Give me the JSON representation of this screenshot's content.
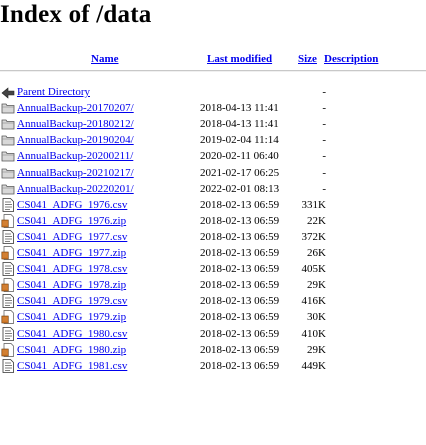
{
  "page": {
    "title": "Index of /data"
  },
  "columns": {
    "name": "Name",
    "last_modified": "Last modified",
    "size": "Size",
    "description": "Description"
  },
  "rows": [
    {
      "icon": "back-icon",
      "name": "Parent Directory",
      "date": "",
      "size": "-"
    },
    {
      "icon": "folder-icon",
      "name": "AnnualBackup-20170207/",
      "date": "2018-04-13 11:41",
      "size": "-"
    },
    {
      "icon": "folder-icon",
      "name": "AnnualBackup-20180212/",
      "date": "2018-04-13 11:41",
      "size": "-"
    },
    {
      "icon": "folder-icon",
      "name": "AnnualBackup-20190204/",
      "date": "2019-02-04 11:14",
      "size": "-"
    },
    {
      "icon": "folder-icon",
      "name": "AnnualBackup-20200211/",
      "date": "2020-02-11 06:40",
      "size": "-"
    },
    {
      "icon": "folder-icon",
      "name": "AnnualBackup-20210217/",
      "date": "2021-02-17 06:25",
      "size": "-"
    },
    {
      "icon": "folder-icon",
      "name": "AnnualBackup-20220201/",
      "date": "2022-02-01 08:13",
      "size": "-"
    },
    {
      "icon": "text-file-icon",
      "name": "CS041_ADFG_1976.csv",
      "date": "2018-02-13 06:59",
      "size": "331K"
    },
    {
      "icon": "compressed-file-icon",
      "name": "CS041_ADFG_1976.zip",
      "date": "2018-02-13 06:59",
      "size": "22K"
    },
    {
      "icon": "text-file-icon",
      "name": "CS041_ADFG_1977.csv",
      "date": "2018-02-13 06:59",
      "size": "372K"
    },
    {
      "icon": "compressed-file-icon",
      "name": "CS041_ADFG_1977.zip",
      "date": "2018-02-13 06:59",
      "size": "26K"
    },
    {
      "icon": "text-file-icon",
      "name": "CS041_ADFG_1978.csv",
      "date": "2018-02-13 06:59",
      "size": "405K"
    },
    {
      "icon": "compressed-file-icon",
      "name": "CS041_ADFG_1978.zip",
      "date": "2018-02-13 06:59",
      "size": "29K"
    },
    {
      "icon": "text-file-icon",
      "name": "CS041_ADFG_1979.csv",
      "date": "2018-02-13 06:59",
      "size": "416K"
    },
    {
      "icon": "compressed-file-icon",
      "name": "CS041_ADFG_1979.zip",
      "date": "2018-02-13 06:59",
      "size": "30K"
    },
    {
      "icon": "text-file-icon",
      "name": "CS041_ADFG_1980.csv",
      "date": "2018-02-13 06:59",
      "size": "410K"
    },
    {
      "icon": "compressed-file-icon",
      "name": "CS041_ADFG_1980.zip",
      "date": "2018-02-13 06:59",
      "size": "29K"
    },
    {
      "icon": "text-file-icon",
      "name": "CS041_ADFG_1981.csv",
      "date": "2018-02-13 06:59",
      "size": "449K"
    }
  ]
}
